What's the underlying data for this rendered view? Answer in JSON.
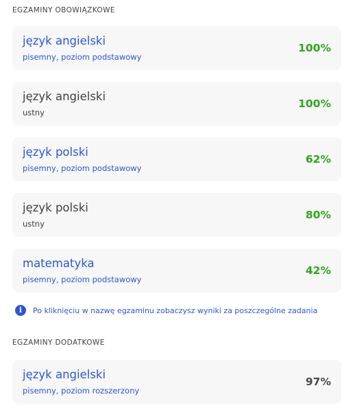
{
  "sections": {
    "mandatory_title": "EGZAMINY OBOWIĄZKOWE",
    "additional_title": "EGZAMINY DODATKOWE"
  },
  "mandatory_exams": [
    {
      "name": "język angielski",
      "detail": "pisemny, poziom podstawowy",
      "score": "100%",
      "clickable": true,
      "score_color": "#2fa41e"
    },
    {
      "name": "język angielski",
      "detail": "ustny",
      "score": "100%",
      "clickable": false,
      "score_color": "#2fa41e"
    },
    {
      "name": "język polski",
      "detail": "pisemny, poziom podstawowy",
      "score": "62%",
      "clickable": true,
      "score_color": "#2fa41e"
    },
    {
      "name": "język polski",
      "detail": "ustny",
      "score": "80%",
      "clickable": false,
      "score_color": "#2fa41e"
    },
    {
      "name": "matematyka",
      "detail": "pisemny, poziom podstawowy",
      "score": "42%",
      "clickable": true,
      "score_color": "#2fa41e"
    }
  ],
  "info": {
    "icon": "info-icon",
    "text": "Po kliknięciu w nazwę egzaminu zobaczysz wyniki za poszczególne zadania"
  },
  "additional_exams": [
    {
      "name": "język angielski",
      "detail": "pisemny, poziom rozszerzony",
      "score": "97%",
      "clickable": true,
      "score_color": "#4a4a4a"
    }
  ],
  "colors": {
    "link": "#2d55d3",
    "text": "#3f3f3f",
    "score_green": "#2fa41e",
    "card_background": "#f7f7f7"
  }
}
